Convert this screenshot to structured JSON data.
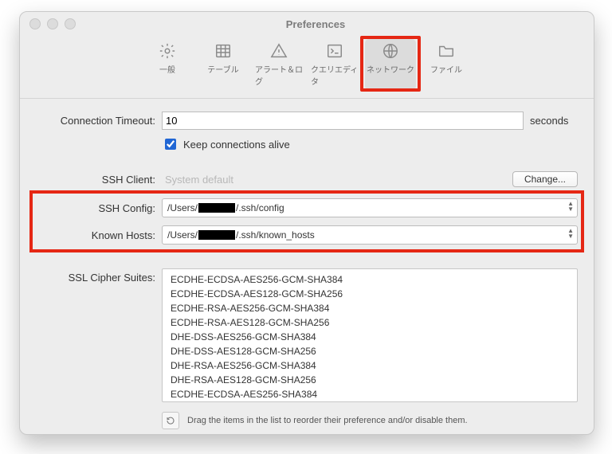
{
  "window": {
    "title": "Preferences"
  },
  "tabs": {
    "general": {
      "label": "一般"
    },
    "tables": {
      "label": "テーブル"
    },
    "alerts": {
      "label": "アラート＆ログ"
    },
    "query": {
      "label": "クエリエディタ"
    },
    "network": {
      "label": "ネットワーク"
    },
    "file": {
      "label": "ファイル"
    }
  },
  "form": {
    "timeout_label": "Connection Timeout:",
    "timeout_value": "10",
    "timeout_unit": "seconds",
    "keepalive_label": "Keep connections alive",
    "ssh_client_label": "SSH Client:",
    "ssh_client_value": "System default",
    "change_btn": "Change...",
    "ssh_config_label": "SSH Config:",
    "ssh_config_prefix": "/Users/",
    "ssh_config_suffix": "/.ssh/config",
    "known_hosts_label": "Known Hosts:",
    "known_hosts_prefix": "/Users/",
    "known_hosts_suffix": "/.ssh/known_hosts",
    "cipher_label": "SSL Cipher Suites:",
    "ciphers": [
      "ECDHE-ECDSA-AES256-GCM-SHA384",
      "ECDHE-ECDSA-AES128-GCM-SHA256",
      "ECDHE-RSA-AES256-GCM-SHA384",
      "ECDHE-RSA-AES128-GCM-SHA256",
      "DHE-DSS-AES256-GCM-SHA384",
      "DHE-DSS-AES128-GCM-SHA256",
      "DHE-RSA-AES256-GCM-SHA384",
      "DHE-RSA-AES128-GCM-SHA256",
      "ECDHE-ECDSA-AES256-SHA384"
    ],
    "hint": "Drag the items in the list to reorder their preference and/or disable them."
  }
}
